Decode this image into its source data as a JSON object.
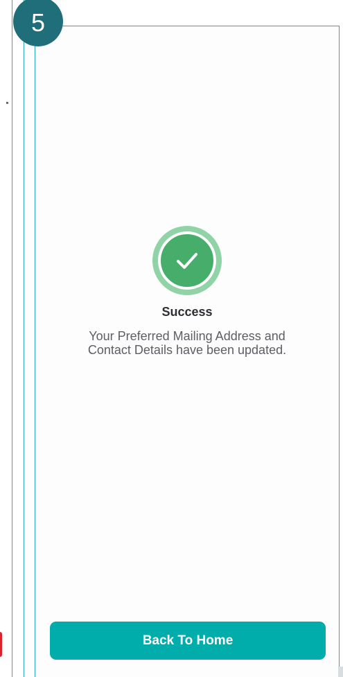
{
  "step": {
    "number": "5"
  },
  "success": {
    "title": "Success",
    "message": "Your Preferred Mailing Address and Contact Details have been updated.",
    "icon": "check-circle-icon"
  },
  "actions": {
    "back_home_label": "Back To Home"
  },
  "colors": {
    "accent": "#00adab",
    "frame": "#26a9b3",
    "badge": "#1f6e7a",
    "success_green": "#46ad6a",
    "success_ring": "#8fd3a6"
  }
}
